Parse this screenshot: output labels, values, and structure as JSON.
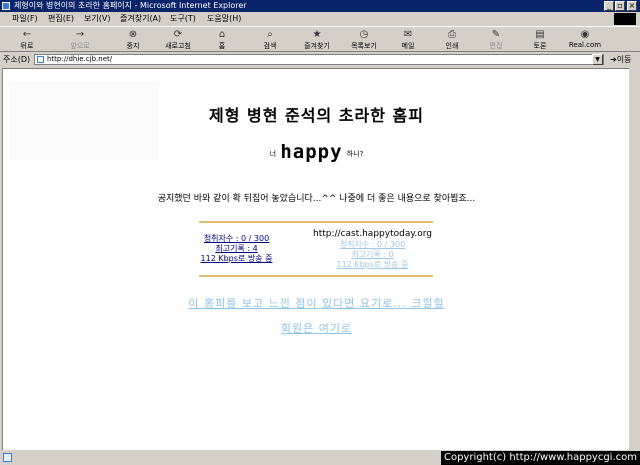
{
  "window": {
    "title": "제형이와 병현이의 초라한 홈페이지 - Microsoft Internet Explorer",
    "minimize": "_",
    "maximize": "▫",
    "close": "×"
  },
  "menu": [
    "파일(F)",
    "편집(E)",
    "보기(V)",
    "즐겨찾기(A)",
    "도구(T)",
    "도움말(H)"
  ],
  "toolbar": {
    "back": "뒤로",
    "forward": "앞으로",
    "stop": "중지",
    "refresh": "새로고침",
    "home": "홈",
    "search": "검색",
    "favorites": "즐겨찾기",
    "history": "목록보기",
    "mail": "메일",
    "print": "인쇄",
    "edit": "편집",
    "discuss": "토론",
    "realcom": "Real.com"
  },
  "address": {
    "label": "주소(D)",
    "url": "http://dhie.cjb.net/",
    "go": "이동"
  },
  "page": {
    "title": "제형 병현 준석의 초라한 홈피",
    "pre": "너",
    "happy": "happy",
    "post": "하니?",
    "notice": "공지했던 바와 같이 확 뒤집어 놓았습니다...^^ 나중에 더 좋은 내용으로 찾아뵙죠...",
    "stats_left": [
      "청취자수 : 0 / 300",
      "최고기록 : 4",
      "112 Kbps로 방송 중"
    ],
    "cast_url": "http://cast.happytoday.org",
    "stats_right": [
      "청취자수 : 0 / 300",
      "최고기록 : 0",
      "112 Kbps로 방송 중"
    ],
    "feedback_link": "이 홈피를 보고 느낀 점이 있다면 요기로... 크힐힐",
    "member_link": "회원은 여기로"
  },
  "status": {
    "copyright": "Copyright(c) http://www.happycgi.com"
  },
  "colors": {
    "titlebar": "#0a246a",
    "link_light": "#8cc4e8",
    "rule": "#e0c070"
  },
  "icons": [
    "ie-icon",
    "back-icon",
    "forward-icon",
    "stop-icon",
    "refresh-icon",
    "home-icon",
    "search-icon",
    "favorites-icon",
    "history-icon",
    "mail-icon",
    "print-icon",
    "edit-icon",
    "discuss-icon",
    "realcom-icon"
  ]
}
